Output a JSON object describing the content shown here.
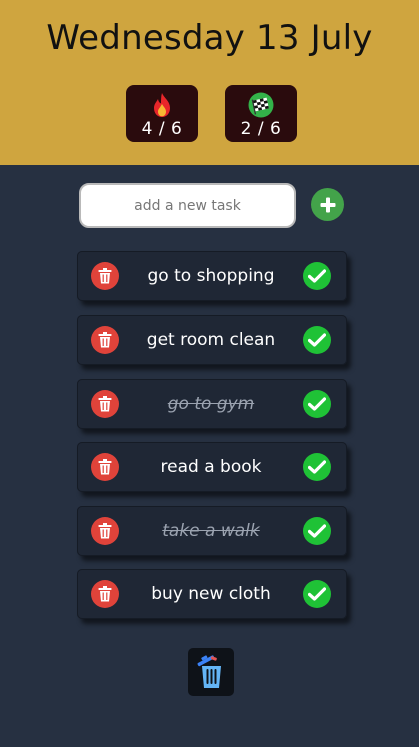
{
  "header": {
    "date": "Wednesday 13 July",
    "stats": {
      "active": {
        "icon": "fire-icon",
        "text": "4 / 6"
      },
      "completed": {
        "icon": "checkered-flag-icon",
        "text": "2 / 6"
      }
    }
  },
  "new_task": {
    "placeholder": "add a new task",
    "value": "",
    "add_icon": "plus-icon"
  },
  "tasks": [
    {
      "text": "go to shopping",
      "done": false
    },
    {
      "text": "get room clean",
      "done": false
    },
    {
      "text": "go to gym",
      "done": true
    },
    {
      "text": "read a book",
      "done": false
    },
    {
      "text": "take a walk",
      "done": true
    },
    {
      "text": "buy new cloth",
      "done": false
    }
  ],
  "footer": {
    "clear_icon": "clear-all-trash-icon"
  },
  "colors": {
    "header_bg": "#cfa53f",
    "page_bg": "#263041",
    "delete": "#e0433a",
    "complete": "#1fc236",
    "add": "#43a34a"
  }
}
